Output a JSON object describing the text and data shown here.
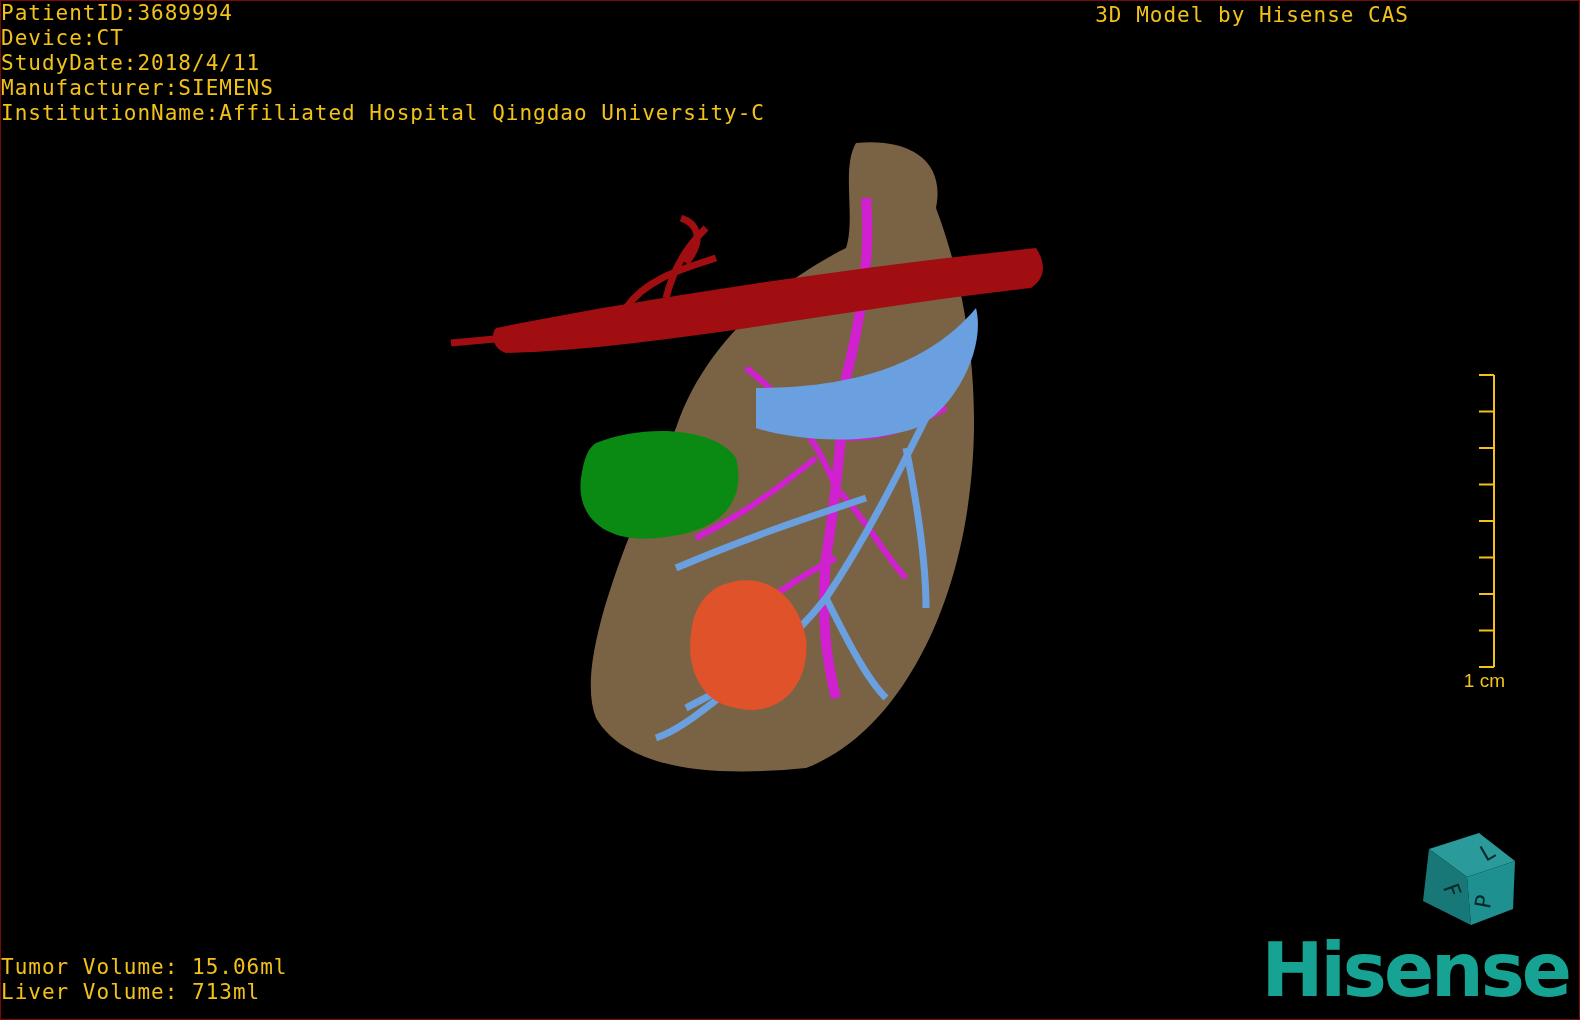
{
  "study_info": [
    "PatientID:3689994",
    "Device:CT",
    "StudyDate:2018/4/11",
    "Manufacturer:SIEMENS",
    "InstitutionName:Affiliated Hospital Qingdao University-C"
  ],
  "credit": "3D Model by Hisense CAS",
  "scale_bar": {
    "label": "1 cm"
  },
  "volumes": [
    "Tumor Volume: 15.06ml",
    "Liver Volume: 713ml"
  ],
  "orientation_cube": {
    "labels": [
      "F",
      "L",
      "P"
    ]
  },
  "logo": "Hisense"
}
